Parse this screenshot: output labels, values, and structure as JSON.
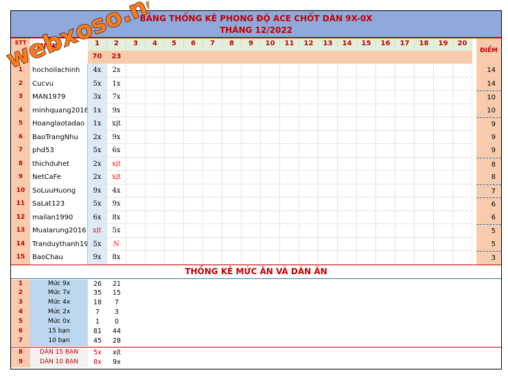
{
  "title": {
    "line1": "BẢNG THỐNG KÊ PHONG ĐỘ ACE CHỐT DÀN 9X-0X",
    "line2": "THÁNG 12/2022"
  },
  "watermark": "webxoso.net",
  "header": {
    "stt": "STT",
    "nick": "NICK",
    "diem": "ĐIỂM",
    "columns": [
      "1",
      "2",
      "3",
      "4",
      "5",
      "6",
      "7",
      "8",
      "9",
      "10",
      "11",
      "12",
      "13",
      "14",
      "15",
      "16",
      "17",
      "18",
      "19",
      "20"
    ],
    "counts": [
      "70",
      "23"
    ]
  },
  "players": [
    {
      "stt": "1",
      "nick": "hochoilachinh",
      "d1": "4x",
      "d2": "2x",
      "score": "14"
    },
    {
      "stt": "2",
      "nick": "Cucvu",
      "d1": "5x",
      "d2": "1x",
      "score": "14"
    },
    {
      "stt": "3",
      "nick": "MAN1979",
      "d1": "3x",
      "d2": "7x",
      "score": "10"
    },
    {
      "stt": "4",
      "nick": "minhquang2016",
      "d1": "1x",
      "d2": "9x",
      "score": "10"
    },
    {
      "stt": "5",
      "nick": "Hoanglaotadao",
      "d1": "1x",
      "d2": "xịt",
      "score": "9"
    },
    {
      "stt": "6",
      "nick": "BaoTrangNhu",
      "d1": "2x",
      "d2": "9x",
      "score": "9"
    },
    {
      "stt": "7",
      "nick": "phd53",
      "d1": "5x",
      "d2": "6x",
      "score": "9"
    },
    {
      "stt": "8",
      "nick": "thichduhet",
      "d1": "2x",
      "d2": "xịt",
      "score": "8"
    },
    {
      "stt": "9",
      "nick": "NetCaFe",
      "d1": "2x",
      "d2": "xịt",
      "score": "8"
    },
    {
      "stt": "10",
      "nick": "SoLuuHuong",
      "d1": "9x",
      "d2": "4x",
      "score": "7"
    },
    {
      "stt": "11",
      "nick": "SaLat123",
      "d1": "5x",
      "d2": "9x",
      "score": "6"
    },
    {
      "stt": "12",
      "nick": "mailan1990",
      "d1": "6x",
      "d2": "8x",
      "score": "6"
    },
    {
      "stt": "13",
      "nick": "Mualarung2016",
      "d1": "xịt",
      "d2": "5x",
      "score": "5"
    },
    {
      "stt": "14",
      "nick": "Tranduythanh19",
      "d1": "5x",
      "d2": "N",
      "score": "5"
    },
    {
      "stt": "15",
      "nick": "BaoChau",
      "d1": "9x",
      "d2": "8x",
      "score": "3"
    }
  ],
  "stats": {
    "title": "THỐNG KÊ MỨC ĂN VÀ DÀN ĂN",
    "rows": [
      {
        "stt": "1",
        "label": "Mức 9x",
        "v1": "26",
        "v2": "21"
      },
      {
        "stt": "2",
        "label": "Mức 7x",
        "v1": "35",
        "v2": "15"
      },
      {
        "stt": "3",
        "label": "Mức 4x",
        "v1": "18",
        "v2": "7"
      },
      {
        "stt": "4",
        "label": "Mức 2x",
        "v1": "7",
        "v2": "3"
      },
      {
        "stt": "5",
        "label": "Mức 0x",
        "v1": "1",
        "v2": "0"
      },
      {
        "stt": "6",
        "label": "15 bạn",
        "v1": "81",
        "v2": "44"
      },
      {
        "stt": "7",
        "label": "10 bạn",
        "v1": "45",
        "v2": "28"
      },
      {
        "stt": "8",
        "label": "DÀN 15 BẠN",
        "v1": "5x",
        "v2": "xịt"
      },
      {
        "stt": "9",
        "label": "DÀN 10 BẠN",
        "v1": "8x",
        "v2": "9x"
      }
    ]
  },
  "colors": {
    "header_blue": "#8ea9db",
    "salmon": "#f8cbad",
    "green": "#e2efda",
    "red": "#c00000",
    "miss": "#ff0000",
    "light_blue": "#bdd7ee",
    "watermark": "#ff6600"
  }
}
